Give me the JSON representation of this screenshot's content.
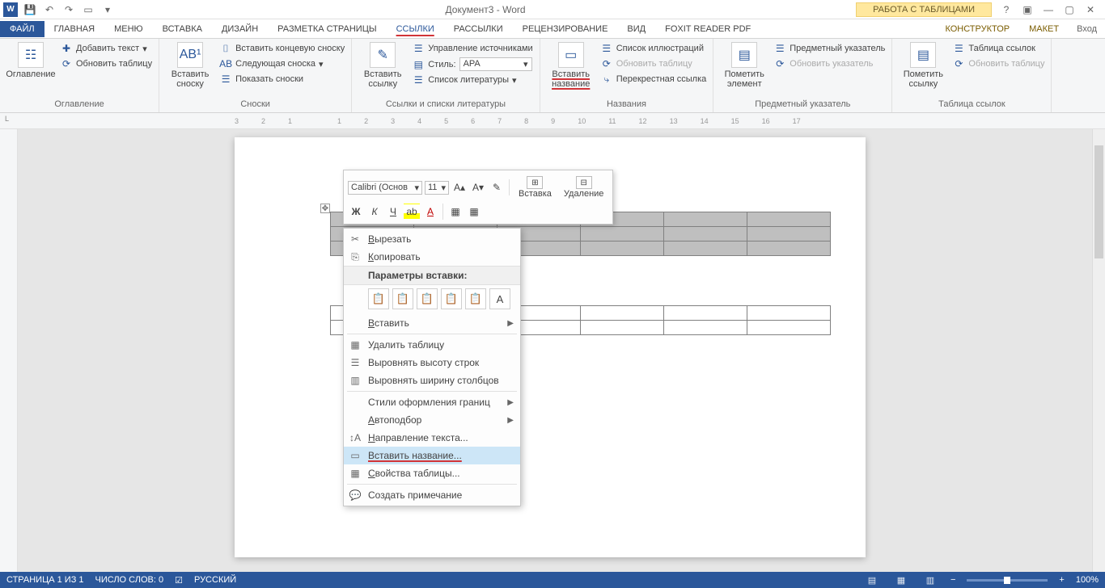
{
  "title": "Документ3 - Word",
  "table_tools": "РАБОТА С ТАБЛИЦАМИ",
  "login": "Вход",
  "tabs": {
    "file": "ФАЙЛ",
    "home": "ГЛАВНАЯ",
    "menu": "Меню",
    "insert": "ВСТАВКА",
    "design": "ДИЗАЙН",
    "layout": "РАЗМЕТКА СТРАНИЦЫ",
    "references": "ССЫЛКИ",
    "mailings": "РАССЫЛКИ",
    "review": "РЕЦЕНЗИРОВАНИЕ",
    "view": "ВИД",
    "foxit": "Foxit Reader PDF",
    "konstructor": "КОНСТРУКТОР",
    "maket": "МАКЕТ"
  },
  "ribbon": {
    "toc": {
      "big": "Оглавление",
      "add_text": "Добавить текст",
      "update": "Обновить таблицу",
      "group": "Оглавление"
    },
    "footnotes": {
      "big": "Вставить\nсноску",
      "end": "Вставить концевую сноску",
      "next": "Следующая сноска",
      "show": "Показать сноски",
      "group": "Сноски"
    },
    "cit": {
      "big": "Вставить\nссылку",
      "sources": "Управление источниками",
      "style_lbl": "Стиль:",
      "style_val": "APA",
      "biblio": "Список литературы",
      "group": "Ссылки и списки литературы"
    },
    "captions": {
      "big": "Вставить\nназвание",
      "illus": "Список иллюстраций",
      "update": "Обновить таблицу",
      "cross": "Перекрестная ссылка",
      "group": "Названия"
    },
    "index": {
      "big": "Пометить\nэлемент",
      "subj": "Предметный указатель",
      "update": "Обновить указатель",
      "group": "Предметный указатель"
    },
    "toa": {
      "big": "Пометить\nссылку",
      "list": "Таблица ссылок",
      "update": "Обновить таблицу",
      "group": "Таблица ссылок"
    }
  },
  "minitb": {
    "font": "Calibri (Основ",
    "size": "11",
    "bold": "Ж",
    "italic": "К",
    "insert": "Вставка",
    "delete": "Удаление"
  },
  "ctx": {
    "cut": "Вырезать",
    "copy": "Копировать",
    "paste_head": "Параметры вставки:",
    "paste": "Вставить",
    "del_table": "Удалить таблицу",
    "dist_rows": "Выровнять высоту строк",
    "dist_cols": "Выровнять ширину столбцов",
    "border_styles": "Стили оформления границ",
    "autofit": "Автоподбор",
    "text_dir": "Направление текста...",
    "ins_caption": "Вставить название...",
    "tbl_props": "Свойства таблицы...",
    "new_comment": "Создать примечание"
  },
  "status": {
    "page": "СТРАНИЦА 1 ИЗ 1",
    "words": "ЧИСЛО СЛОВ: 0",
    "lang": "РУССКИЙ",
    "zoom": "100%"
  },
  "ruler_marks": [
    "3",
    "2",
    "1",
    "",
    "1",
    "2",
    "3",
    "4",
    "5",
    "6",
    "7",
    "8",
    "9",
    "10",
    "11",
    "12",
    "13",
    "14",
    "15",
    "16",
    "17"
  ]
}
